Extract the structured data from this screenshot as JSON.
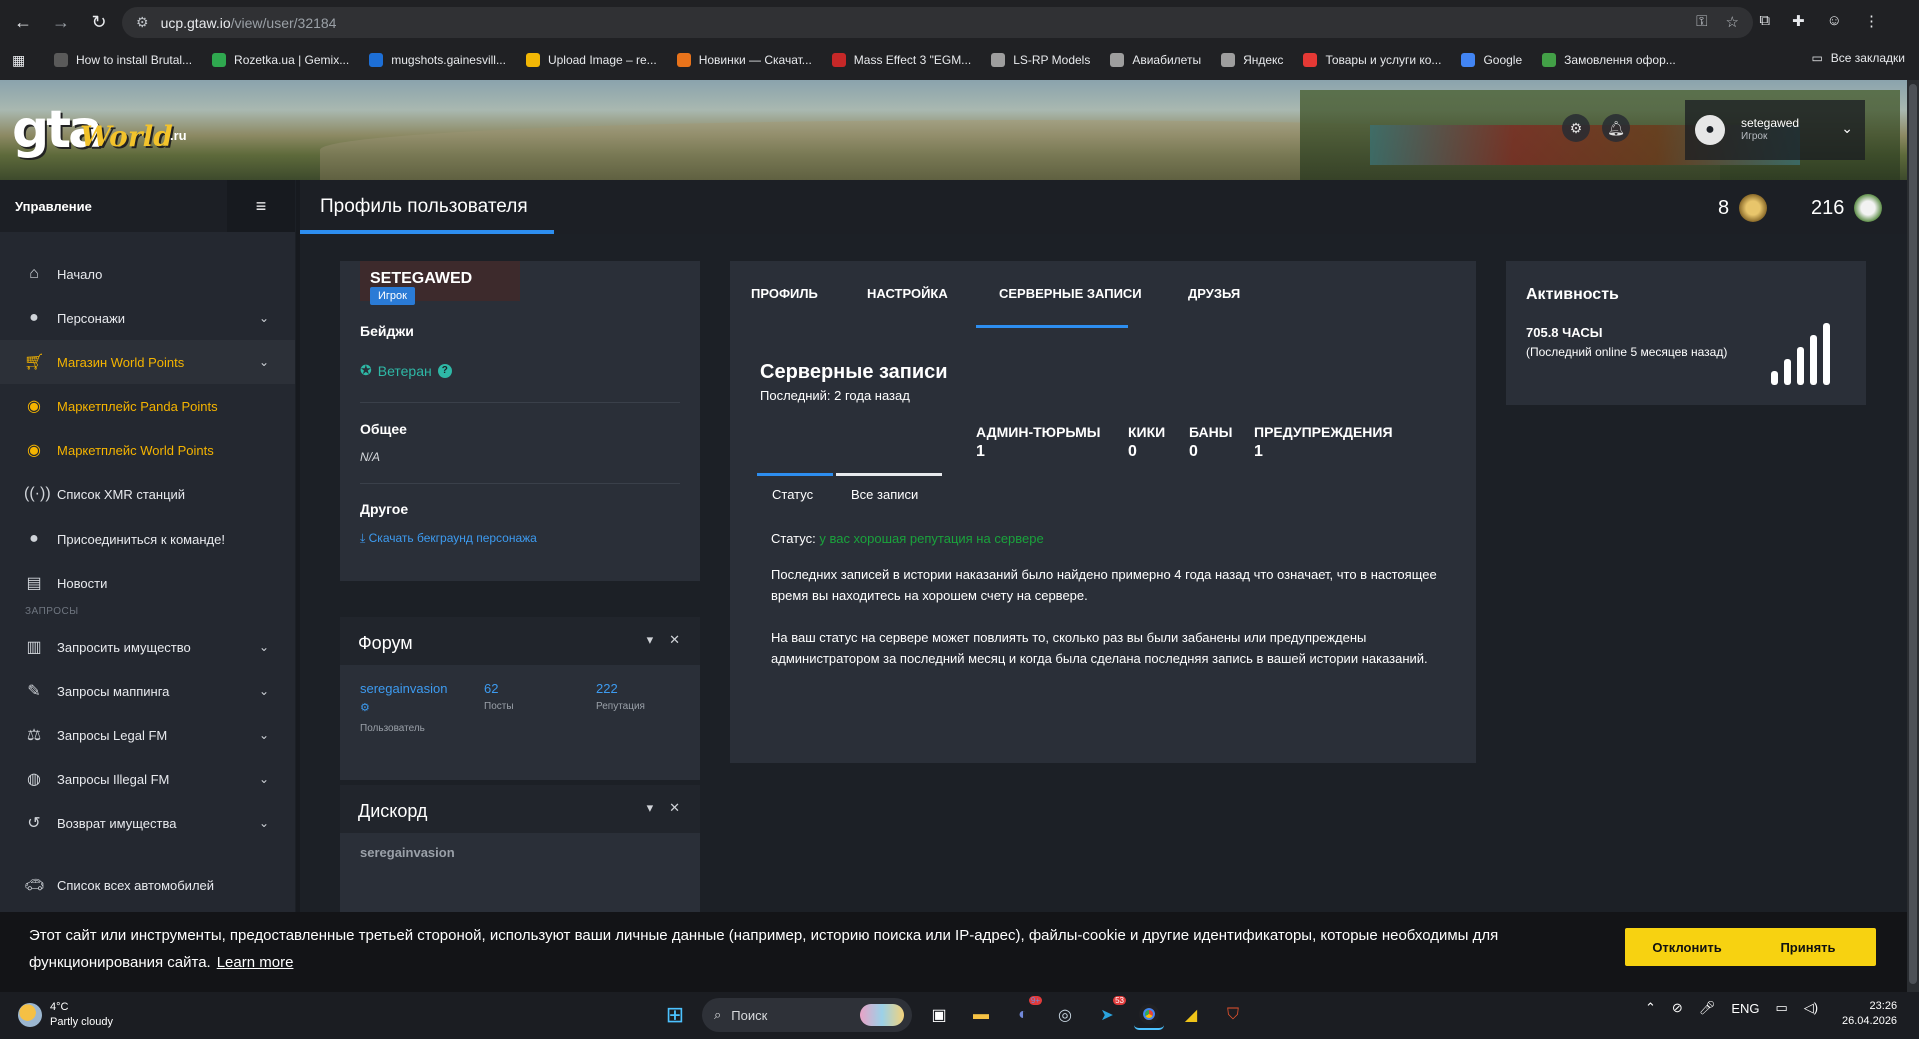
{
  "browser": {
    "url_host": "ucp.gtaw.io",
    "url_path": "/view/user/32184",
    "bookmarks": [
      {
        "label": "How to install Brutal...",
        "color": "#5a5a5a"
      },
      {
        "label": "Rozetka.ua | Gemix...",
        "color": "#2fa84f"
      },
      {
        "label": "mugshots.gainesvill...",
        "color": "#1d6fd6"
      },
      {
        "label": "Upload Image – re...",
        "color": "#f2b705"
      },
      {
        "label": "Новинки — Скачат...",
        "color": "#e8731b"
      },
      {
        "label": "Mass Effect 3 \"EGM...",
        "color": "#c62828"
      },
      {
        "label": "LS-RP Models",
        "color": "#9e9e9e"
      },
      {
        "label": "Авиабилеты",
        "color": "#9e9e9e"
      },
      {
        "label": "Яндекс",
        "color": "#9e9e9e"
      },
      {
        "label": "Товары и услуги ко...",
        "color": "#e53935"
      },
      {
        "label": "Google",
        "color": "#4285f4"
      },
      {
        "label": "Замовлення офор...",
        "color": "#43a047"
      }
    ],
    "all_bookmarks": "Все закладки"
  },
  "header": {
    "logo_gta": "gta",
    "logo_world": "World",
    "logo_ru": ".ru",
    "username": "setegawed",
    "user_role": "Игрок"
  },
  "sidebar": {
    "title": "Управление",
    "items": [
      {
        "label": "Начало",
        "icon": "home-icon"
      },
      {
        "label": "Персонажи",
        "icon": "user-icon"
      },
      {
        "label": "Магазин World Points",
        "icon": "cart-icon"
      },
      {
        "label": "Маркетплейс Panda Points",
        "icon": "coins-icon"
      },
      {
        "label": "Маркетплейс World Points",
        "icon": "coins-icon"
      },
      {
        "label": "Список XMR станций",
        "icon": "antenna-icon"
      },
      {
        "label": "Присоединиться к команде!",
        "icon": "user-plus-icon"
      },
      {
        "label": "Новости",
        "icon": "news-icon"
      }
    ],
    "section_requests": "ЗАПРОСЫ",
    "request_items": [
      {
        "label": "Запросить имущество",
        "icon": "building-icon"
      },
      {
        "label": "Запросы маппинга",
        "icon": "brush-icon"
      },
      {
        "label": "Запросы Legal FM",
        "icon": "scale-icon"
      },
      {
        "label": "Запросы Illegal FM",
        "icon": "mask-icon"
      },
      {
        "label": "Возврат имущества",
        "icon": "undo-icon"
      },
      {
        "label": "Список всех автомобилей",
        "icon": "car-icon"
      }
    ]
  },
  "page": {
    "title": "Профиль пользователя",
    "stat_1": "8",
    "stat_2": "216"
  },
  "profile": {
    "name": "SETEGAWED",
    "role": "Игрок",
    "badges_label": "Бейджи",
    "badge_veteran": "Ветеран",
    "general_label": "Общее",
    "general_value": "N/A",
    "other_label": "Другое",
    "download_link": "Скачать бекграунд персонажа"
  },
  "forum": {
    "title": "Форум",
    "username": "seregainvasion",
    "user_sub": "Пользователь",
    "posts": "62",
    "posts_label": "Посты",
    "reputation": "222",
    "reputation_label": "Репутация"
  },
  "discord": {
    "title": "Дискорд",
    "username": "seregainvasion"
  },
  "records": {
    "tabs": [
      "ПРОФИЛЬ",
      "НАСТРОЙКА",
      "СЕРВЕРНЫЕ ЗАПИСИ",
      "ДРУЗЬЯ"
    ],
    "title": "Серверные записи",
    "last": "Последний: 2 года назад",
    "counts": [
      {
        "label": "АДМИН-ТЮРЬМЫ",
        "value": "1"
      },
      {
        "label": "КИКИ",
        "value": "0"
      },
      {
        "label": "БАНЫ",
        "value": "0"
      },
      {
        "label": "ПРЕДУПРЕЖДЕНИЯ",
        "value": "1"
      }
    ],
    "subtab_status": "Статус",
    "subtab_all": "Все записи",
    "status_label": "Статус:",
    "status_value": "у вас хорошая репутация на сервере",
    "para_1": "Последних записей в истории наказаний было найдено примерно 4 года назад что означает, что в настоящее время вы находитесь на хорошем счету на сервере.",
    "para_2": "На ваш статус на сервере может повлиять то, сколько раз вы были забанены или предупреждены администратором за последний месяц и когда была сделана последняя запись в вашей истории наказаний."
  },
  "activity": {
    "title": "Активность",
    "hours": "705.8 ЧАСЫ",
    "last_online": "(Последний online 5 месяцев назад)"
  },
  "cookie": {
    "text": "Этот сайт или инструменты, предоставленные третьей стороной, используют ваши личные данные (например, историю поиска или IP-адрес), файлы-cookie и другие идентификаторы, которые необходимы для функционирования сайта.",
    "learn_more": "Learn more",
    "decline": "Отклонить",
    "accept": "Принять"
  },
  "taskbar": {
    "temp": "4°C",
    "weather": "Partly cloudy",
    "search": "Поиск",
    "lang": "ENG",
    "time": "23:26",
    "date": "26.04.2026",
    "discord_badge": "9+",
    "telegram_badge": "53"
  }
}
